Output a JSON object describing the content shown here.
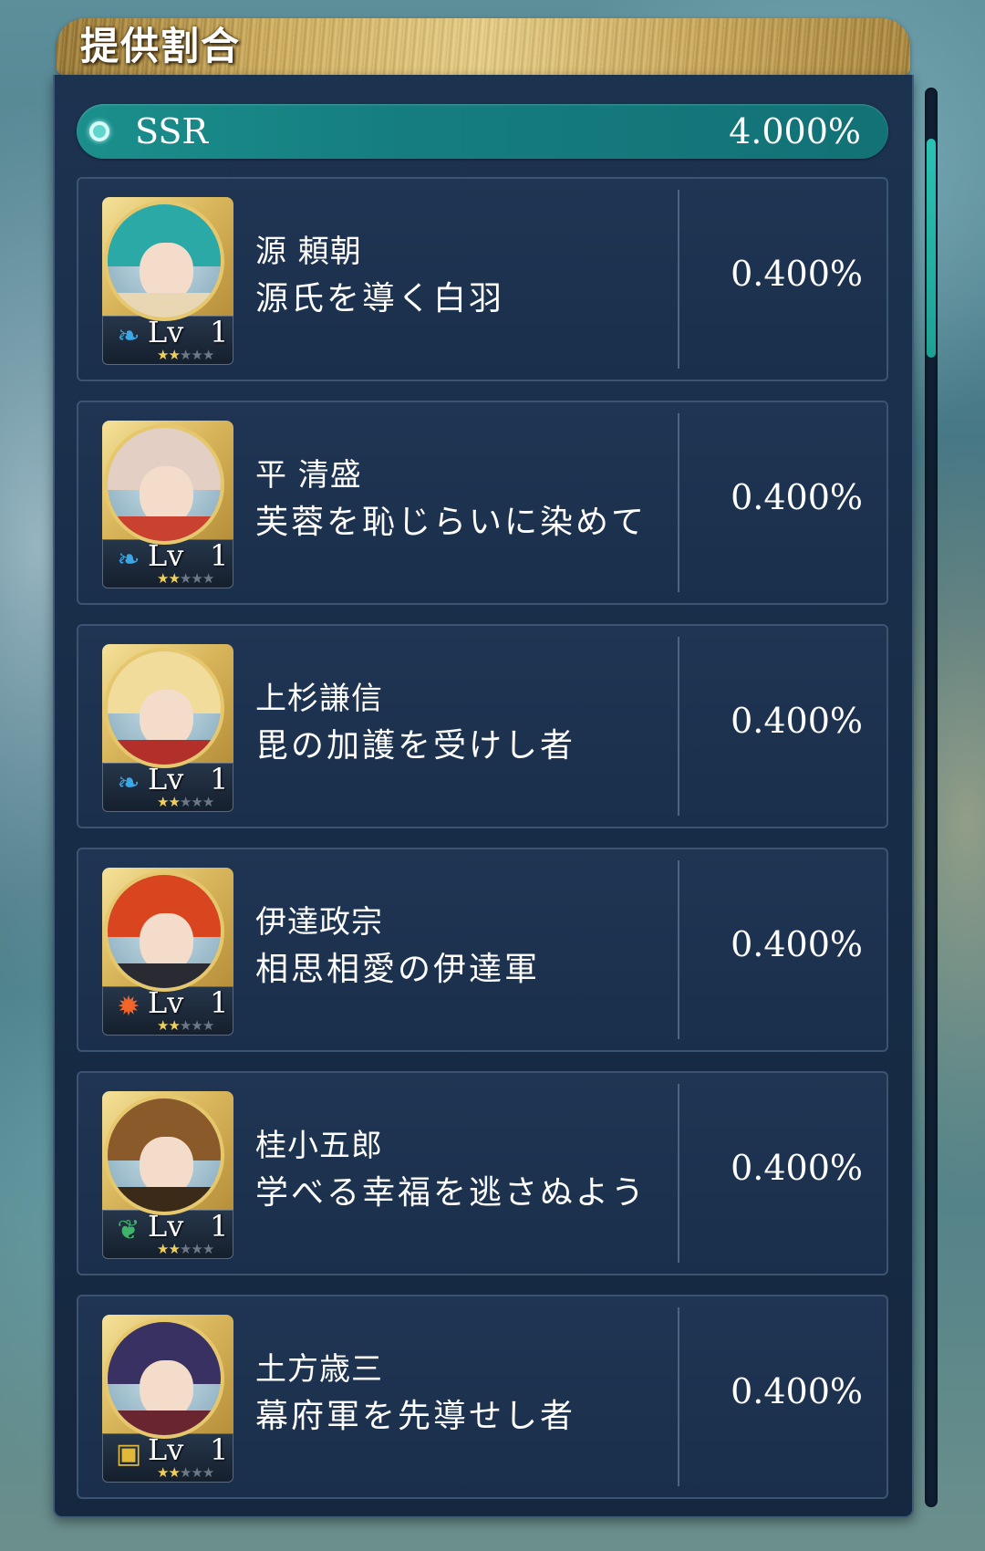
{
  "header": {
    "title": "提供割合"
  },
  "rarity": {
    "label": "SSR",
    "rate": "4.000%"
  },
  "characters": [
    {
      "name": "源 頼朝",
      "title": "源氏を導く白羽",
      "level_label": "Lv",
      "level": "1",
      "element": "water-leaf-icon",
      "stars_filled": 2,
      "stars_total": 5,
      "rate": "0.400%",
      "hair_color": "#2aa9a6",
      "cloth_color": "#e8d7b2"
    },
    {
      "name": "平 清盛",
      "title": "芙蓉を恥じらいに染めて",
      "level_label": "Lv",
      "level": "1",
      "element": "water-leaf-icon",
      "stars_filled": 2,
      "stars_total": 5,
      "rate": "0.400%",
      "hair_color": "#e3cfc3",
      "cloth_color": "#c9412f"
    },
    {
      "name": "上杉謙信",
      "title": "毘の加護を受けし者",
      "level_label": "Lv",
      "level": "1",
      "element": "water-leaf-icon",
      "stars_filled": 2,
      "stars_total": 5,
      "rate": "0.400%",
      "hair_color": "#f1dc9c",
      "cloth_color": "#b32f2a"
    },
    {
      "name": "伊達政宗",
      "title": "相思相愛の伊達軍",
      "level_label": "Lv",
      "level": "1",
      "element": "fire-icon",
      "stars_filled": 2,
      "stars_total": 5,
      "rate": "0.400%",
      "hair_color": "#d8451f",
      "cloth_color": "#2a2a32"
    },
    {
      "name": "桂小五郎",
      "title": "学べる幸福を逃さぬよう",
      "level_label": "Lv",
      "level": "1",
      "element": "wind-leaves-icon",
      "stars_filled": 2,
      "stars_total": 5,
      "rate": "0.400%",
      "hair_color": "#8a5a2a",
      "cloth_color": "#3b2a18"
    },
    {
      "name": "土方歳三",
      "title": "幕府軍を先導せし者",
      "level_label": "Lv",
      "level": "1",
      "element": "earth-blocks-icon",
      "stars_filled": 2,
      "stars_total": 5,
      "rate": "0.400%",
      "hair_color": "#3a3163",
      "cloth_color": "#6a2630"
    }
  ],
  "colors": {
    "accent_teal": "#1b8f8c",
    "scrollbar": "#2bc2b3",
    "gold": "#d8b55a",
    "panel": "#1a2f4b"
  }
}
